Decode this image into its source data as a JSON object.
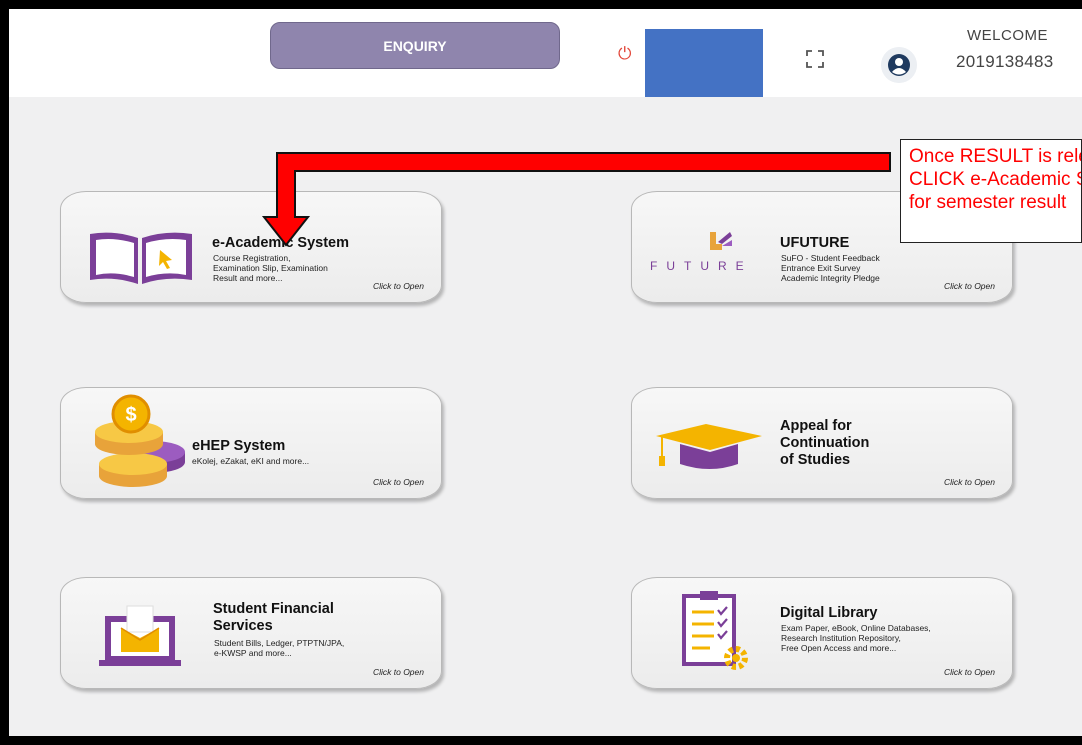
{
  "header": {
    "enquiry_label": "ENQUIRY",
    "welcome_text": "WELCOME",
    "user_id": "2019138483",
    "power_icon": "power-icon",
    "fullscreen_icon": "fullscreen-icon",
    "avatar_icon": "user-avatar-icon",
    "accent_color": "#8f85ad"
  },
  "cards": [
    {
      "title": "e-Academic System",
      "description": "Course Registration,\nExamination Slip, Examination\nResult and more...",
      "open_label": "Click to Open",
      "icon": "open-book-cursor-icon"
    },
    {
      "title": "UFUTURE",
      "description": "SuFO - Student Feedback\nEntrance Exit Survey\nAcademic Integrity Pledge",
      "open_label": "Click to Open",
      "icon": "ufuture-logo-icon",
      "logo_text": "FUTURE"
    },
    {
      "title": "eHEP System",
      "description": "eKolej, eZakat, eKI and more...",
      "open_label": "Click to Open",
      "icon": "coins-stack-icon"
    },
    {
      "title": "Appeal for\nContinuation\nof Studies",
      "description": "",
      "open_label": "Click to Open",
      "icon": "graduation-cap-icon"
    },
    {
      "title": "Student Financial\nServices",
      "description": "Student Bills, Ledger, PTPTN/JPA,\ne-KWSP and more...",
      "open_label": "Click to Open",
      "icon": "laptop-envelope-icon"
    },
    {
      "title": "Digital Library",
      "description": "Exam Paper, eBook, Online Databases,\nResearch Institution Repository,\nFree Open Access and more...",
      "open_label": "Click to Open",
      "icon": "checklist-gear-icon"
    }
  ],
  "annotation": {
    "lines": [
      "Once RESULT is released,",
      "CLICK e-Academic System",
      "for semester result"
    ],
    "color": "#ff0000"
  }
}
